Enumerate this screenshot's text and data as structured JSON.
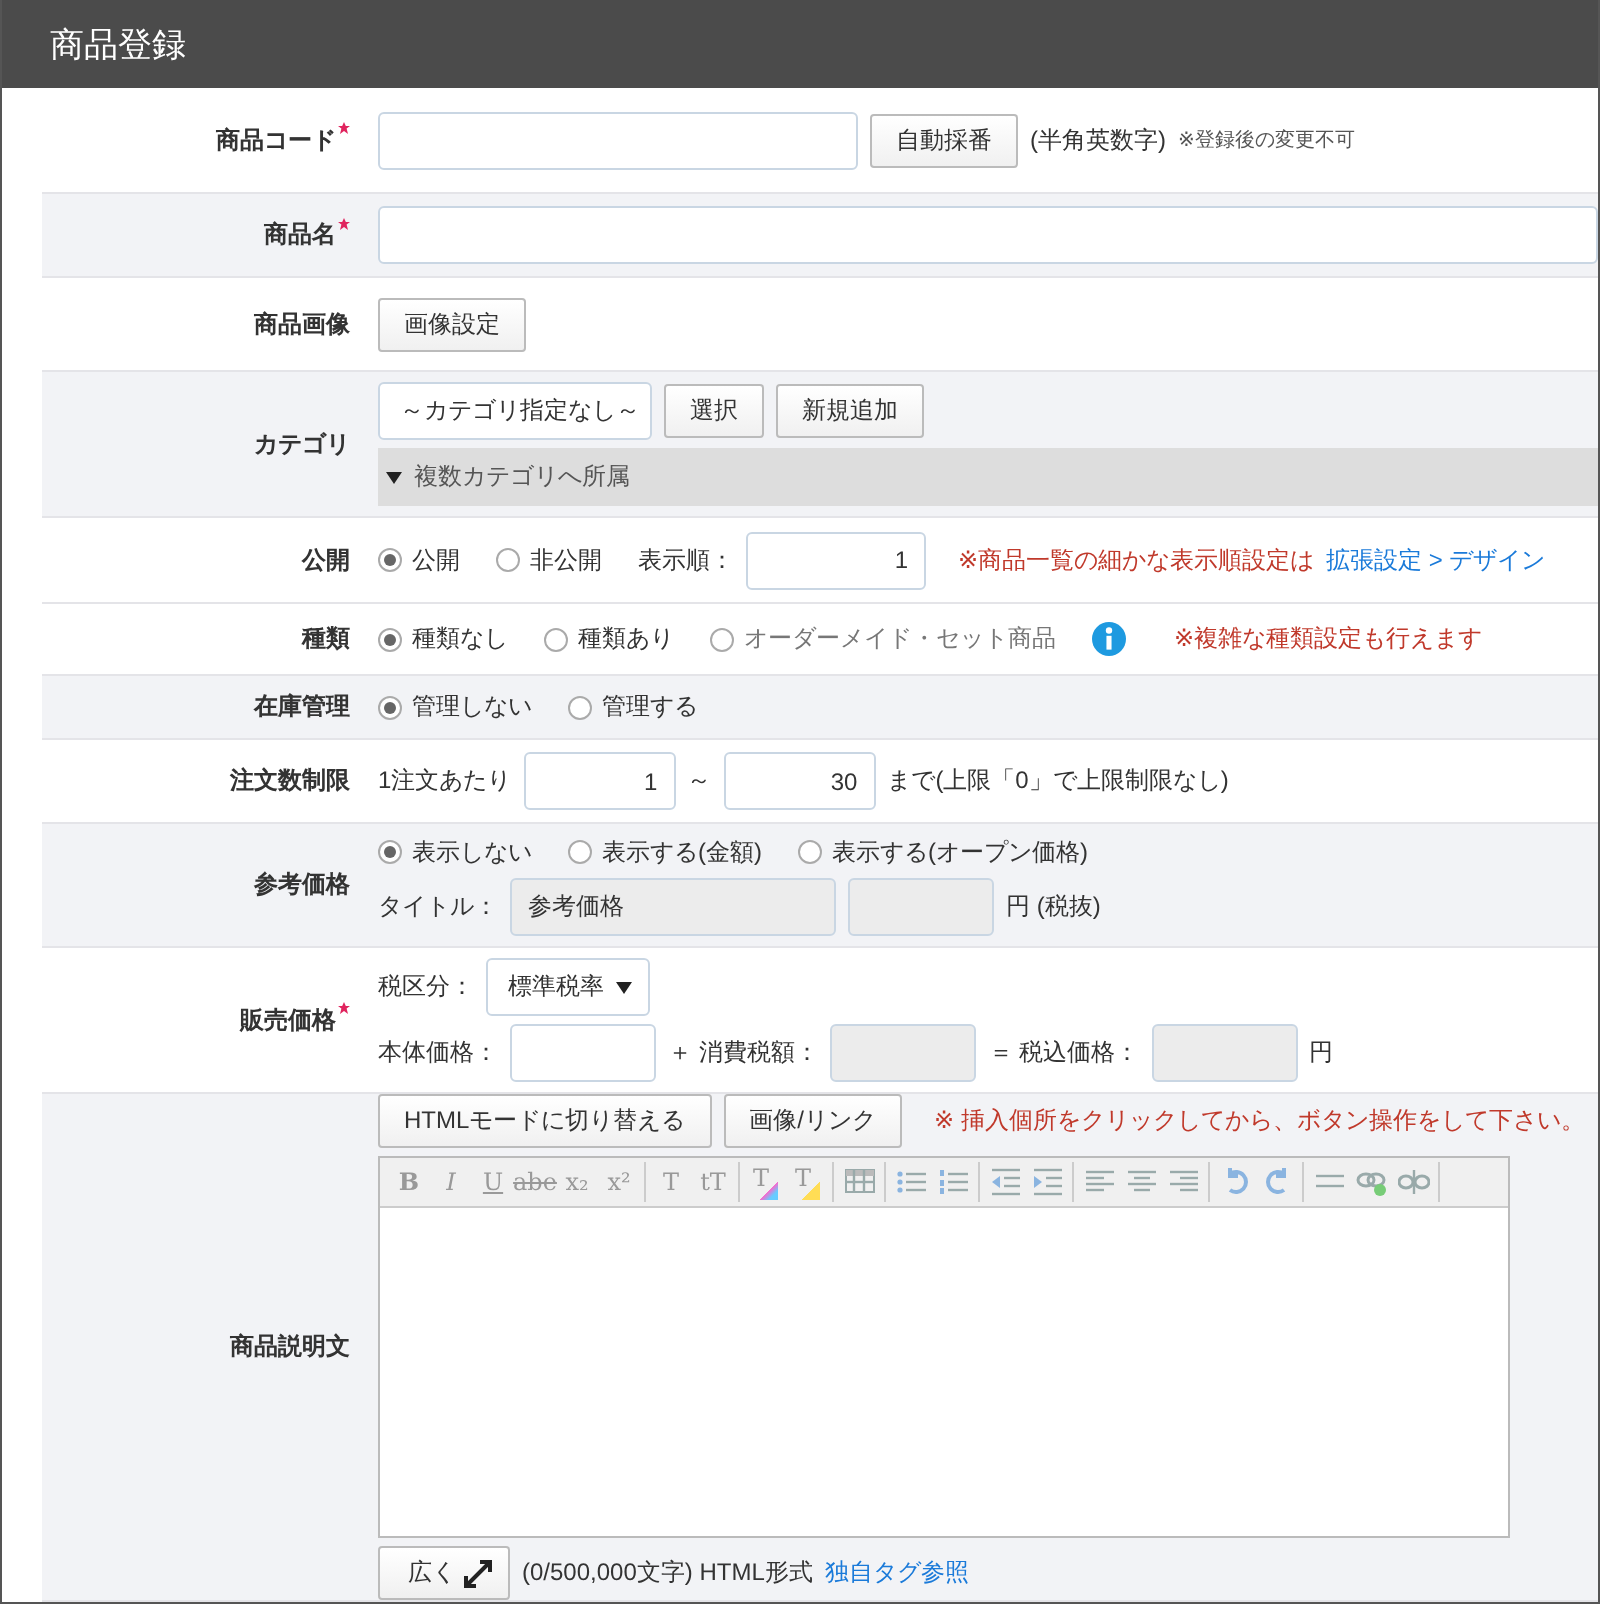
{
  "title": "商品登録",
  "rows": [
    {
      "label": "商品コード",
      "required": true,
      "highlighted": false,
      "lines": [
        [
          {
            "kind": "input",
            "disabled": false
          },
          {
            "kind": "button",
            "label": "自動採番"
          },
          {
            "kind": "text",
            "text": "(半角英数字)"
          },
          {
            "kind": "hint",
            "text": "※登録後の変更不可"
          }
        ]
      ]
    },
    {
      "label": "商品名",
      "required": true,
      "highlighted": true,
      "lines": [
        [
          {
            "kind": "input",
            "disabled": false
          }
        ]
      ]
    },
    {
      "label": "商品画像",
      "required": false,
      "highlighted": false,
      "lines": [
        [
          {
            "kind": "button",
            "label": "画像設定"
          }
        ]
      ]
    },
    {
      "label": "カテゴリ",
      "required": false,
      "highlighted": true,
      "lines": [
        [
          {
            "kind": "select",
            "value": "～カテゴリ指定なし～"
          },
          {
            "kind": "button",
            "label": "選択"
          },
          {
            "kind": "button",
            "label": "新規追加"
          }
        ],
        [
          {
            "kind": "expander",
            "label": "複数カテゴリへ所属"
          }
        ]
      ]
    },
    {
      "label": "公開",
      "required": false,
      "highlighted": false,
      "lines": [
        [
          {
            "kind": "radio",
            "label": "公開",
            "selected": true,
            "disabled": false
          },
          {
            "kind": "radio",
            "label": "非公開",
            "selected": false,
            "disabled": false
          },
          {
            "kind": "text",
            "text": "表示順："
          },
          {
            "kind": "input",
            "value": "1",
            "disabled": false
          },
          {
            "kind": "note",
            "text": "※商品一覧の細かな表示順設定は"
          },
          {
            "kind": "link",
            "text": "拡張設定 > デザイン"
          }
        ]
      ]
    },
    {
      "label": "種類",
      "required": false,
      "highlighted": false,
      "lines": [
        [
          {
            "kind": "radio",
            "label": "種類なし",
            "selected": true,
            "disabled": false
          },
          {
            "kind": "radio",
            "label": "種類あり",
            "selected": false,
            "disabled": false
          },
          {
            "kind": "radio",
            "label": "オーダーメイド・セット商品",
            "selected": false,
            "disabled": true
          },
          {
            "kind": "info"
          },
          {
            "kind": "note",
            "text": "※複雑な種類設定も行えます"
          }
        ]
      ]
    },
    {
      "label": "在庫管理",
      "required": false,
      "highlighted": true,
      "lines": [
        [
          {
            "kind": "radio",
            "label": "管理しない",
            "selected": true,
            "disabled": false
          },
          {
            "kind": "radio",
            "label": "管理する",
            "selected": false,
            "disabled": false
          }
        ]
      ]
    },
    {
      "label": "注文数制限",
      "required": false,
      "highlighted": false,
      "lines": [
        [
          {
            "kind": "text",
            "text": "1注文あたり"
          },
          {
            "kind": "input",
            "value": "1",
            "disabled": false
          },
          {
            "kind": "text",
            "text": "～"
          },
          {
            "kind": "input",
            "value": "30",
            "disabled": false
          },
          {
            "kind": "text",
            "text": "まで(上限「0」で上限制限なし)"
          }
        ]
      ]
    },
    {
      "label": "参考価格",
      "required": false,
      "highlighted": true,
      "lines": [
        [
          {
            "kind": "radio",
            "label": "表示しない",
            "selected": true,
            "disabled": false
          },
          {
            "kind": "radio",
            "label": "表示する(金額)",
            "selected": false,
            "disabled": false
          },
          {
            "kind": "radio",
            "label": "表示する(オープン価格)",
            "selected": false,
            "disabled": false
          }
        ],
        [
          {
            "kind": "text",
            "text": "タイトル："
          },
          {
            "kind": "input",
            "value": "参考価格",
            "disabled": true
          },
          {
            "kind": "input",
            "disabled": true
          },
          {
            "kind": "text",
            "text": "円 (税抜)"
          }
        ]
      ]
    },
    {
      "label": "販売価格",
      "required": true,
      "highlighted": false,
      "lines": [
        [
          {
            "kind": "text",
            "text": "税区分："
          },
          {
            "kind": "select",
            "value": "標準税率"
          }
        ],
        [
          {
            "kind": "text",
            "text": "本体価格："
          },
          {
            "kind": "input",
            "disabled": false
          },
          {
            "kind": "text",
            "text": "＋ 消費税額："
          },
          {
            "kind": "input",
            "disabled": true
          },
          {
            "kind": "text",
            "text": "＝ 税込価格："
          },
          {
            "kind": "input",
            "disabled": true
          },
          {
            "kind": "text",
            "text": "円"
          }
        ]
      ]
    },
    {
      "label": "商品説明文",
      "required": false,
      "highlighted": true,
      "lines": [
        [
          {
            "kind": "button",
            "label": "HTMLモードに切り替える"
          },
          {
            "kind": "button",
            "label": "画像/リンク"
          },
          {
            "kind": "note",
            "text": "※ 挿入個所をクリックしてから、ボタン操作をして下さい。"
          }
        ],
        [
          {
            "kind": "editor",
            "toolbar": [
              [
                {
                  "kind": "bold",
                  "label": "B"
                },
                {
                  "kind": "italic",
                  "label": "I"
                },
                {
                  "kind": "underline",
                  "label": "U"
                },
                {
                  "kind": "strike",
                  "label": "abe"
                },
                {
                  "kind": "plain",
                  "label": "x₂"
                },
                {
                  "kind": "plain",
                  "label": "x²"
                }
              ],
              [
                {
                  "kind": "plain",
                  "label": "T"
                },
                {
                  "kind": "plain",
                  "label": "tT"
                }
              ],
              [
                {
                  "kind": "text-color",
                  "label": "T"
                },
                {
                  "kind": "highlight",
                  "label": "T"
                }
              ],
              [
                {
                  "kind": "table"
                }
              ],
              [
                {
                  "kind": "bullet-list"
                },
                {
                  "kind": "numbered-list"
                }
              ],
              [
                {
                  "kind": "outdent"
                },
                {
                  "kind": "indent"
                }
              ],
              [
                {
                  "kind": "align-left"
                },
                {
                  "kind": "align-center"
                },
                {
                  "kind": "align-right"
                }
              ],
              [
                {
                  "kind": "undo"
                },
                {
                  "kind": "redo"
                }
              ],
              [
                {
                  "kind": "rule"
                },
                {
                  "kind": "link"
                },
                {
                  "kind": "unlink"
                }
              ]
            ]
          }
        ],
        [
          {
            "kind": "expand-button",
            "label": "広く"
          },
          {
            "kind": "text",
            "text": "(0/500,000文字) HTML形式"
          },
          {
            "kind": "link",
            "text": "独自タグ参照"
          }
        ]
      ]
    }
  ]
}
